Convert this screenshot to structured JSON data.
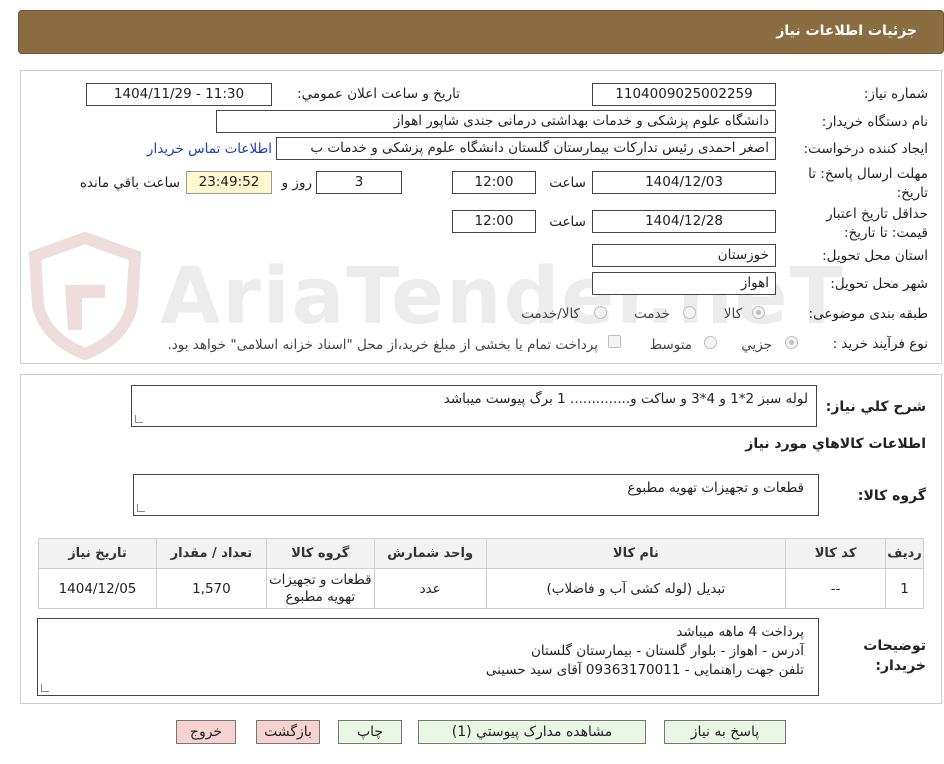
{
  "header": {
    "title": "جزئیات اطلاعات نیاز"
  },
  "watermark": {
    "text": "AriaTender.neT"
  },
  "form": {
    "need_number_label": "شماره نیاز:",
    "need_number_value": "1104009025002259",
    "announce_label": "تاریخ و ساعت اعلان عمومي:",
    "announce_value": "1404/11/29 - 11:30",
    "buyer_org_label": "نام دستگاه خريدار:",
    "buyer_org_value": "دانشگاه علوم پزشکی و خدمات بهداشتی درمانی جندی شاپور اهواز",
    "requester_label": "ايجاد کننده درخواست:",
    "requester_value": "اصغر احمدی رئیس تداركات بیمارستان گلستان دانشگاه علوم پزشکی و خدمات ب",
    "contact_link": "اطلاعات تماس خريدار",
    "reply_deadline_label": "مهلت ارسال پاسخ: تا تاریخ:",
    "reply_date": "1404/12/03",
    "time_label": "ساعت",
    "reply_time": "12:00",
    "days_value": "3",
    "days_label": "روز و",
    "remaining_time": "23:49:52",
    "remaining_label": "ساعت باقي مانده",
    "validity_label": "حداقل تاريخ اعتبار قيمت: تا تاريخ:",
    "validity_date": "1404/12/28",
    "validity_time_label": "ساعت",
    "validity_time": "12:00",
    "province_label": "استان محل تحويل:",
    "province_value": "خوزستان",
    "city_label": "شهر محل تحويل:",
    "city_value": "اهواز",
    "category_label": "طبقه بندی موضوعی:",
    "category_options": [
      "کالا",
      "خدمت",
      "کالا/خدمت"
    ],
    "purchase_type_label": "نوع فرآيند خريد :",
    "purchase_options": [
      "جزيي",
      "متوسط"
    ],
    "purchase_note": "پرداخت تمام یا بخشی از مبلغ خرید،از محل \"اسناد خزانه اسلامی\" خواهد بود."
  },
  "description": {
    "label": "شرح كلي نياز:",
    "value": "لوله سبز 2*1 و 4*3 و ساکت و.............. 1 برگ پیوست میباشد"
  },
  "goods": {
    "section_title": "اطلاعات كالاهاي مورد نياز",
    "group_label": "گروه كالا:",
    "group_value": "قطعات و تجهیزات تهویه مطبوع",
    "columns": [
      "رديف",
      "كد كالا",
      "نام كالا",
      "واحد شمارش",
      "گروه كالا",
      "تعداد / مقدار",
      "تاريخ نياز"
    ],
    "rows": [
      [
        "1",
        "--",
        "تبدیل (لوله کشی آب و فاضلاب)",
        "عدد",
        "قطعات و تجهیزات تهویه مطبوع",
        "1,570",
        "1404/12/05"
      ]
    ]
  },
  "buyer_notes": {
    "label": "توضيحات خريدار:",
    "lines": [
      "پرداخت 4 ماهه میباشد",
      "آدرس - اهواز - بلوار گلستان - بیمارستان گلستان",
      "تلفن جهت راهنمایی - 09363170011 آقای سید حسینی"
    ]
  },
  "buttons": {
    "reply": "پاسخ به نياز",
    "view_docs": "مشاهده مدارک پيوستي (1)",
    "print": "چاپ",
    "back": "بازگشت",
    "exit": "خروج"
  },
  "colors": {
    "header_bg": "#8b6d42",
    "button_green": "#eaf6e6",
    "button_red": "#f6d2d2",
    "link": "#1a3fb0"
  }
}
